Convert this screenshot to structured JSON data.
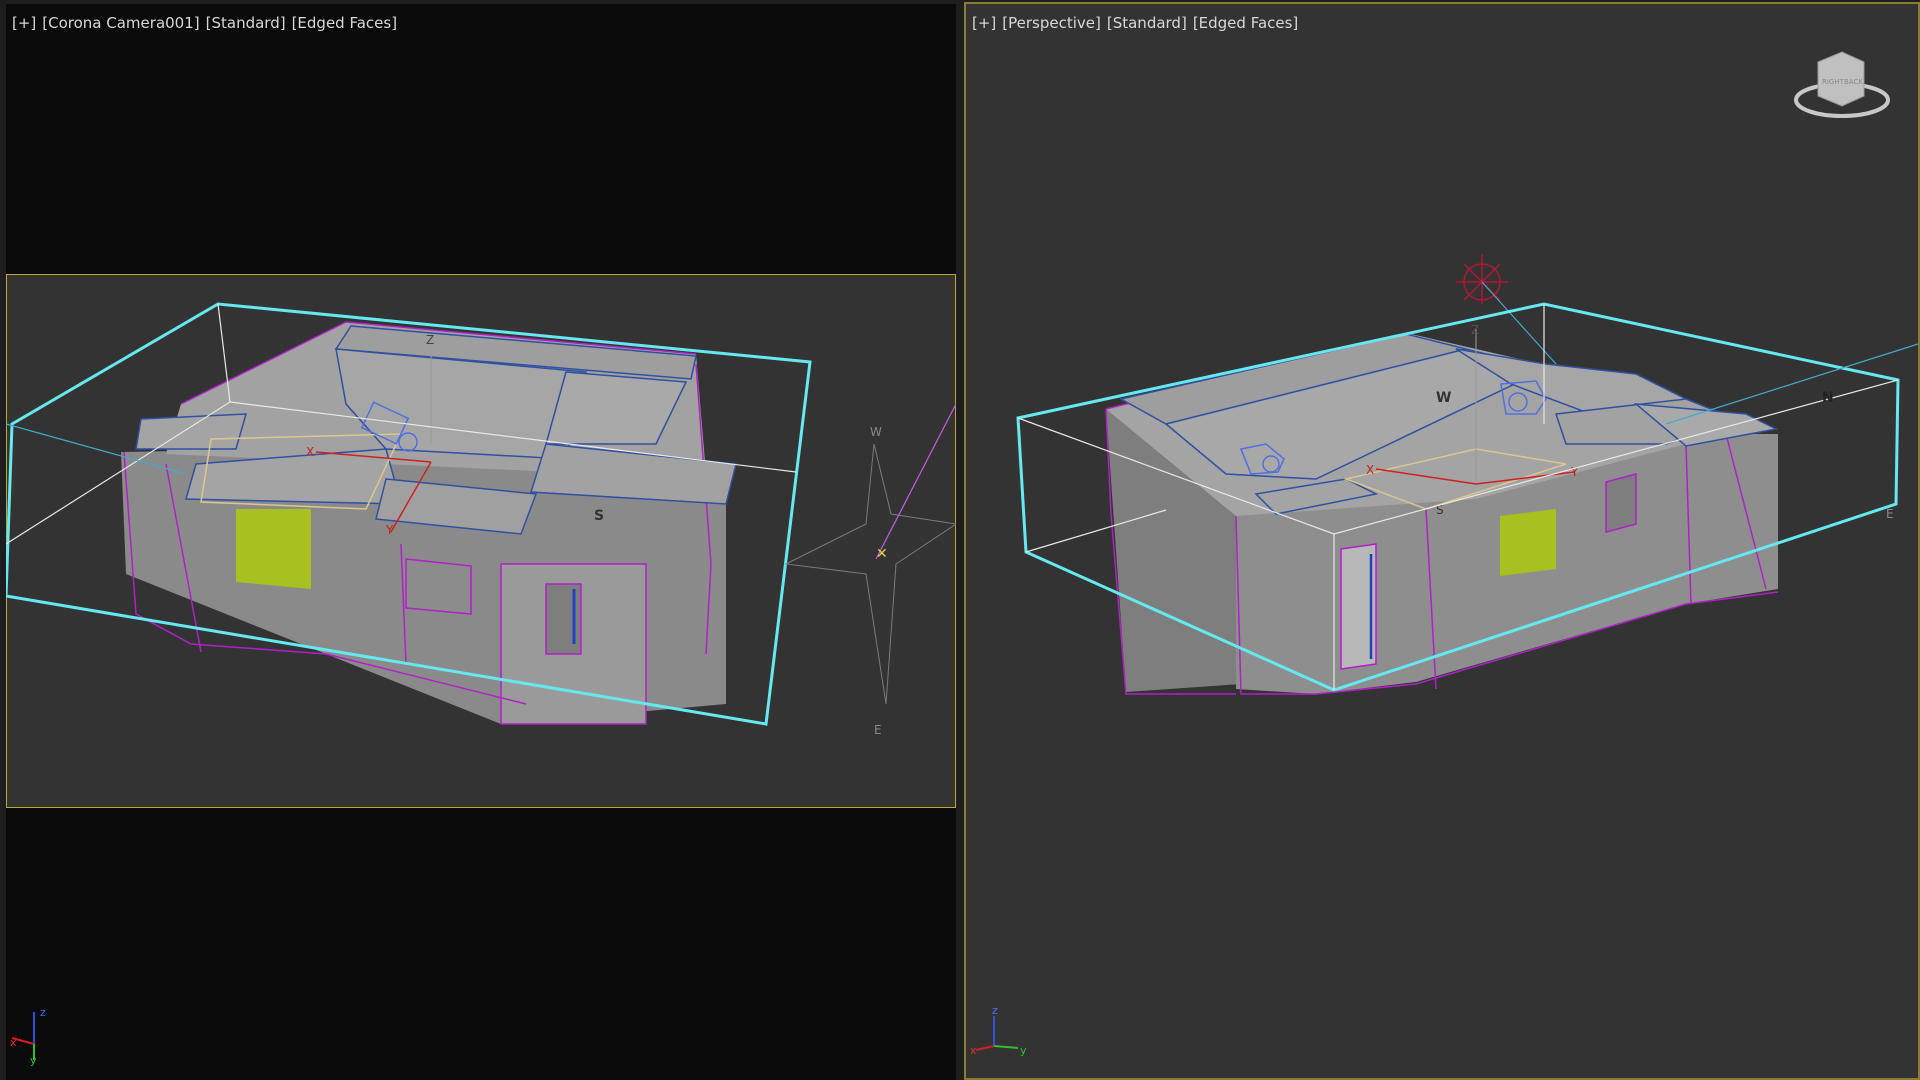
{
  "left_viewport": {
    "labels": [
      "[+]",
      "[Corona Camera001]",
      "[Standard]",
      "[Edged Faces]"
    ],
    "compass": {
      "w": "W",
      "e": "E",
      "s": "S"
    },
    "gizmo": {
      "z": "Z",
      "x": "X",
      "y": "Y"
    },
    "axis_tripod": {
      "x": "x",
      "y": "y",
      "z": "z"
    }
  },
  "right_viewport": {
    "labels": [
      "[+]",
      "[Perspective]",
      "[Standard]",
      "[Edged Faces]"
    ],
    "compass": {
      "w": "W",
      "n": "N",
      "e": "E",
      "s": "S"
    },
    "gizmo": {
      "z": "Z",
      "x": "X",
      "y": "Y"
    },
    "viewcube": {
      "left": "RIGHT",
      "right": "BACK"
    },
    "axis_tripod": {
      "x": "x",
      "y": "y",
      "z": "z"
    }
  },
  "colors": {
    "selection": "#66e8f0",
    "walls": "#b020c8",
    "panels": "#3050a0",
    "window": "#a8c020",
    "frame_border": "#b9a738",
    "active_border": "#8d7a34"
  }
}
